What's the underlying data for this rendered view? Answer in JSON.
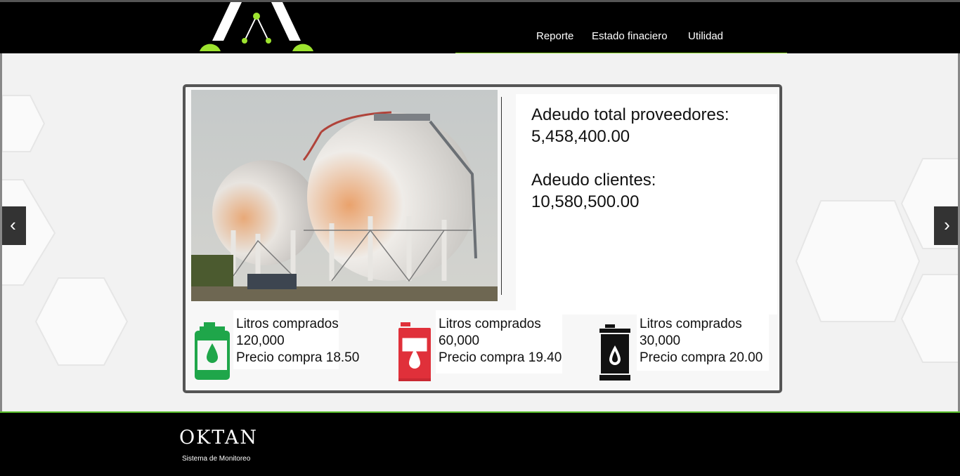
{
  "header": {
    "logo_icon": "oktan-logo-icon",
    "nav": [
      {
        "label": "Reporte"
      },
      {
        "label": "Estado finaciero"
      },
      {
        "label": "Utilidad"
      }
    ],
    "accent_color": "#8ddb2a"
  },
  "carousel": {
    "prev_label": "‹",
    "next_label": "›"
  },
  "summary": {
    "photo_subject": "gas-storage-spheres",
    "supplier_debt_label": "Adeudo total proveedores:",
    "supplier_debt_value": "5,458,400.00",
    "client_debt_label": "Adeudo clientes:",
    "client_debt_value": "10,580,500.00"
  },
  "fuels": [
    {
      "icon": "green-jerrycan-icon",
      "color": "#1fa64a",
      "label": "Litros comprados",
      "liters": "120,000",
      "price": "Precio compra 18.50"
    },
    {
      "icon": "red-jerrycan-icon",
      "color": "#e0303a",
      "label": "Litros comprados",
      "liters": "60,000",
      "price": "Precio compra 19.40"
    },
    {
      "icon": "black-barrel-icon",
      "color": "#111111",
      "label": "Litros comprados",
      "liters": "30,000",
      "price": "Precio compra 20.00"
    }
  ],
  "footer": {
    "brand": "OKTAN",
    "subtitle": "Sistema de Monitoreo"
  }
}
